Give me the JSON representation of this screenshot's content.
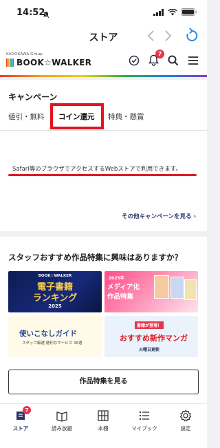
{
  "status": {
    "time": "14:52"
  },
  "nav": {
    "title": "ストア"
  },
  "header": {
    "brand_group": "KADOKAWA Group",
    "brand_name": "BOOK☆WALKER",
    "notification_count": "7"
  },
  "campaign": {
    "title": "キャンペーン",
    "tabs": [
      {
        "label": "値引・無料"
      },
      {
        "label": "コイン還元"
      },
      {
        "label": "特典・懸賞"
      }
    ],
    "notice": "Safari等のブラウザでアクセスするWebストアで利用できます。",
    "other_link": "その他キャンペーンを見る ›"
  },
  "staff": {
    "title": "スタッフおすすめ作品特集に興味はありますか？",
    "banners": [
      {
        "line1": "BOOK☆WALKER",
        "line2": "電子書籍",
        "line3": "ランキング",
        "line4": "2025"
      },
      {
        "line1": "2025年",
        "line2": "メディア化",
        "line3": "作品特集"
      },
      {
        "line1": "使いこなしガイド",
        "line2": "スタッフ厳選 便利なサービス 35選"
      },
      {
        "line1": "書籍が登場！",
        "line2": "おすすめ新作マンガ",
        "line3": "火曜日更新"
      }
    ],
    "more_button": "作品特集を見る"
  },
  "tabbar": {
    "items": [
      {
        "label": "ストア",
        "badge": "7"
      },
      {
        "label": "読み放題"
      },
      {
        "label": "本棚"
      },
      {
        "label": "マイブック"
      },
      {
        "label": "設定"
      }
    ]
  },
  "colors": {
    "accent_red": "#e0151f",
    "navy": "#2a3560",
    "badge": "#e8344e"
  }
}
